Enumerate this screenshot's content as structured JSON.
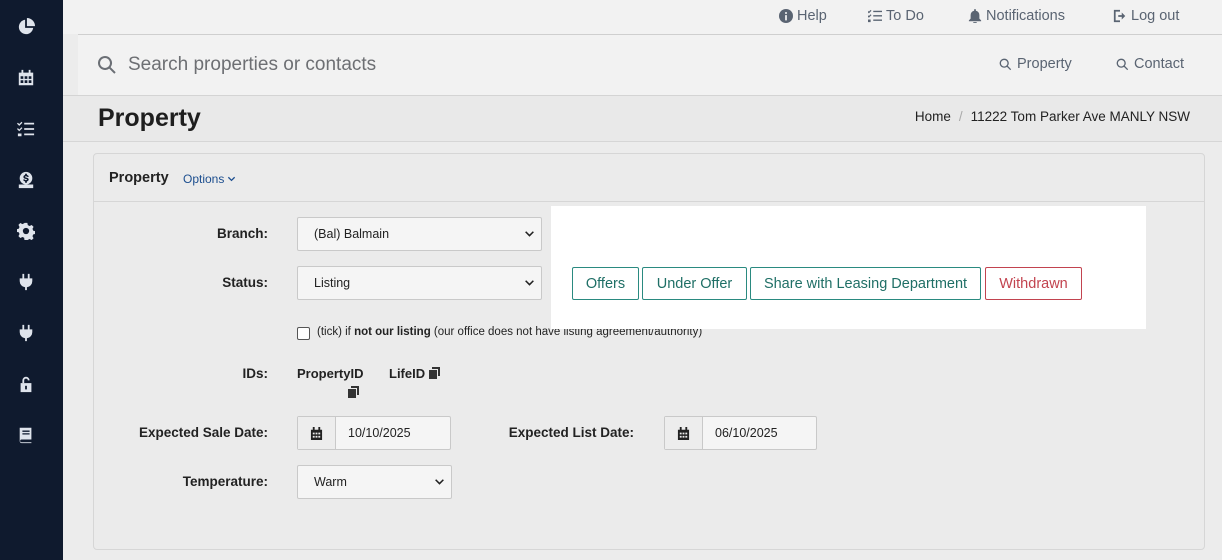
{
  "topbar": {
    "help": "Help",
    "todo": "To Do",
    "notifications": "Notifications",
    "logout": "Log out"
  },
  "search": {
    "placeholder": "Search properties or contacts",
    "scope_property": "Property",
    "scope_contact": "Contact"
  },
  "page": {
    "title": "Property",
    "breadcrumb": [
      "Home",
      "11222 Tom Parker Ave MANLY NSW"
    ]
  },
  "card": {
    "title": "Property",
    "options": "Options"
  },
  "form": {
    "branch_label": "Branch:",
    "branch_value": "(Bal) Balmain",
    "status_label": "Status:",
    "status_value": "Listing",
    "not_listing_pre": "(tick) if ",
    "not_listing_bold": "not our listing",
    "not_listing_post": " (our office does not have listing agreement/authority)",
    "ids_label": "IDs:",
    "property_id": "PropertyID",
    "life_id": "LifeID",
    "expected_sale_label": "Expected Sale Date:",
    "expected_sale_value": "10/10/2025",
    "expected_list_label": "Expected List Date:",
    "expected_list_value": "06/10/2025",
    "temperature_label": "Temperature:",
    "temperature_value": "Warm"
  },
  "actions": {
    "offers": "Offers",
    "under_offer": "Under Offer",
    "share_leasing": "Share with Leasing Department",
    "withdrawn": "Withdrawn"
  },
  "sidebar": {
    "icons": [
      "chart-pie-icon",
      "calendar-icon",
      "tasks-icon",
      "money-icon",
      "gear-icon",
      "plug-icon",
      "plug-icon",
      "lock-icon",
      "book-icon"
    ]
  }
}
